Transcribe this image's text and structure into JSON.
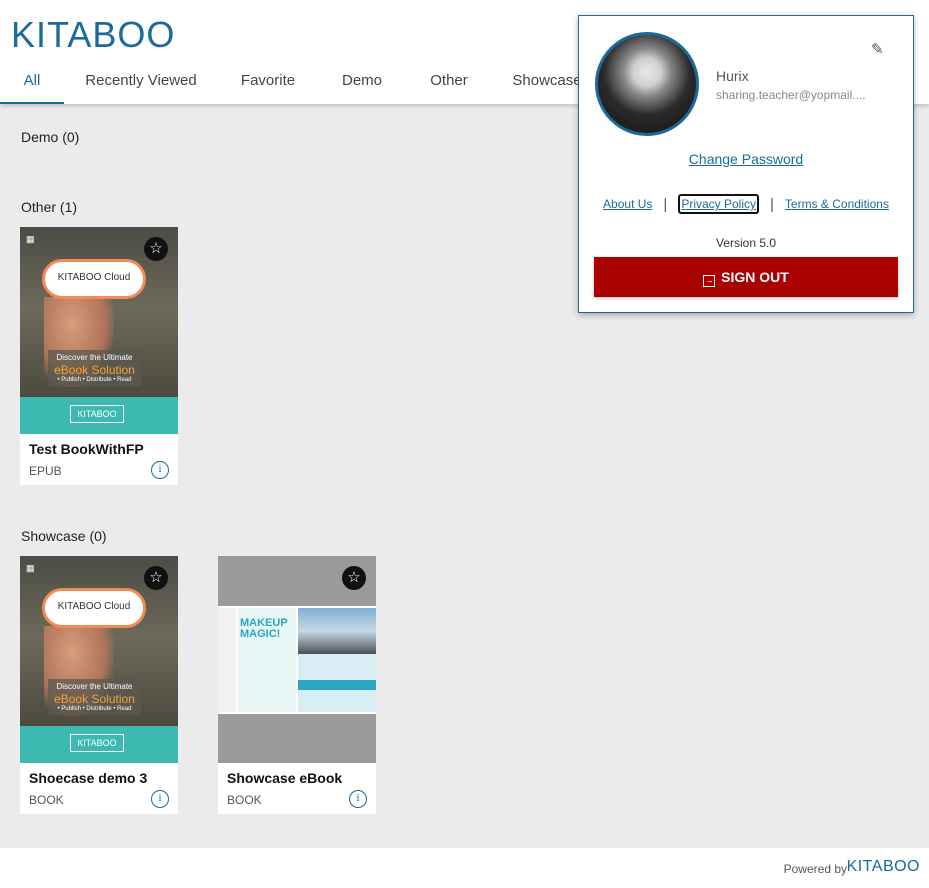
{
  "header": {
    "logo_text": "KITABOO",
    "tabs": [
      {
        "label": "All",
        "active": true
      },
      {
        "label": "Recently Viewed"
      },
      {
        "label": "Favorite"
      },
      {
        "label": "Demo"
      },
      {
        "label": "Other"
      },
      {
        "label": "Showcase"
      }
    ]
  },
  "sections": {
    "demo": {
      "title": "Demo (0)"
    },
    "other": {
      "title": "Other (1)"
    },
    "showcase": {
      "title": "Showcase (0)"
    }
  },
  "books": [
    {
      "title": "Test BookWithFP",
      "type": "EPUB",
      "cover": {
        "cloud": "KITABOO Cloud",
        "line1": "Discover the Ultimate",
        "line2": "eBook Solution",
        "line3": "• Publish • Distribute • Read",
        "brand": "KITABOO"
      }
    },
    {
      "title": "Shoecase demo 3",
      "type": "BOOK",
      "cover": {
        "cloud": "KITABOO Cloud",
        "line1": "Discover the Ultimate",
        "line2": "eBook Solution",
        "line3": "• Publish • Distribute • Read",
        "brand": "KITABOO"
      }
    },
    {
      "title": "Showcase eBook",
      "type": "BOOK",
      "cover": {
        "headline": "MAKEUP MAGIC!"
      }
    }
  ],
  "profile": {
    "name": "Hurix",
    "email": "sharing.teacher@yopmail....",
    "change_password": "Change Password",
    "links": [
      "About Us",
      "Privacy Policy",
      "Terms & Conditions"
    ],
    "version": "Version 5.0",
    "signout": "SIGN OUT"
  },
  "footer": {
    "powered_by": "Powered by",
    "logo_text": "KITABOO"
  },
  "colors": {
    "brand": "#1a6a9a",
    "signout": "#a90000",
    "teal": "#3cbab1"
  }
}
